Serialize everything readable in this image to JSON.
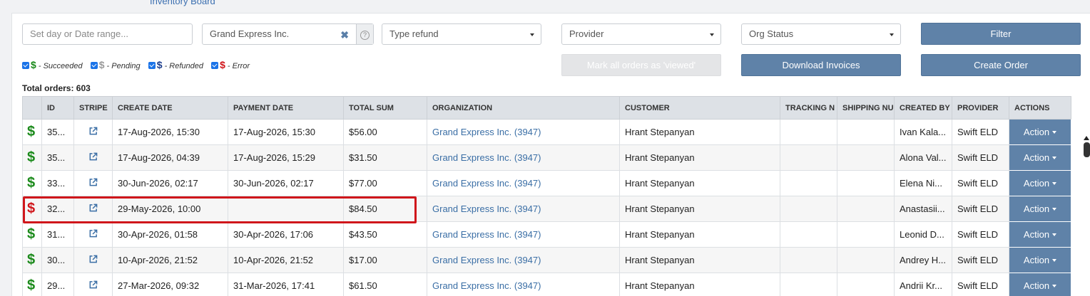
{
  "top_link": "Inventory Board",
  "filters": {
    "date_placeholder": "Set day or Date range...",
    "organization_value": "Grand Express Inc.",
    "refund_type": "Type refund",
    "provider": "Provider",
    "org_status": "Org Status",
    "filter_label": "Filter",
    "mark_viewed_label": "Mark all orders as 'viewed'",
    "download_label": "Download Invoices",
    "create_label": "Create Order"
  },
  "legend": [
    {
      "symbol": "$",
      "label": "- Succeeded",
      "color": "#1b8a1b"
    },
    {
      "symbol": "$",
      "label": "- Pending",
      "color": "#9a9a9a"
    },
    {
      "symbol": "$",
      "label": "- Refunded",
      "color": "#1c3d8c"
    },
    {
      "symbol": "$",
      "label": "- Error",
      "color": "#d0161b"
    }
  ],
  "total_orders": "Total orders: 603",
  "columns": [
    "",
    "ID",
    "STRIPE",
    "CREATE DATE",
    "PAYMENT DATE",
    "TOTAL SUM",
    "ORGANIZATION",
    "CUSTOMER",
    "TRACKING N",
    "SHIPPING NU",
    "CREATED BY",
    "PROVIDER",
    "ACTIONS"
  ],
  "rows": [
    {
      "status": "succeeded",
      "symbol": "$",
      "id": "35...",
      "create_date": "17-Aug-2026, 15:30",
      "payment_date": "17-Aug-2026, 15:30",
      "total": "$56.00",
      "organization": "Grand Express Inc. (3947)",
      "customer": "Hrant Stepanyan",
      "tracking": "",
      "shipping": "",
      "created_by": "Ivan Kala...",
      "provider": "Swift ELD",
      "action": "Action"
    },
    {
      "status": "succeeded",
      "symbol": "$",
      "id": "35...",
      "create_date": "17-Aug-2026, 04:39",
      "payment_date": "17-Aug-2026, 15:29",
      "total": "$31.50",
      "organization": "Grand Express Inc. (3947)",
      "customer": "Hrant Stepanyan",
      "tracking": "",
      "shipping": "",
      "created_by": "Alona Val...",
      "provider": "Swift ELD",
      "action": "Action"
    },
    {
      "status": "succeeded",
      "symbol": "$",
      "id": "33...",
      "create_date": "30-Jun-2026, 02:17",
      "payment_date": "30-Jun-2026, 02:17",
      "total": "$77.00",
      "organization": "Grand Express Inc. (3947)",
      "customer": "Hrant Stepanyan",
      "tracking": "",
      "shipping": "",
      "created_by": "Elena Ni...",
      "provider": "Swift ELD",
      "action": "Action"
    },
    {
      "status": "error",
      "symbol": "$",
      "id": "32...",
      "create_date": "29-May-2026, 10:00",
      "payment_date": "",
      "total": "$84.50",
      "organization": "Grand Express Inc. (3947)",
      "customer": "Hrant Stepanyan",
      "tracking": "",
      "shipping": "",
      "created_by": "Anastasii...",
      "provider": "Swift ELD",
      "action": "Action"
    },
    {
      "status": "succeeded",
      "symbol": "$",
      "id": "31...",
      "create_date": "30-Apr-2026, 01:58",
      "payment_date": "30-Apr-2026, 17:06",
      "total": "$43.50",
      "organization": "Grand Express Inc. (3947)",
      "customer": "Hrant Stepanyan",
      "tracking": "",
      "shipping": "",
      "created_by": "Leonid D...",
      "provider": "Swift ELD",
      "action": "Action"
    },
    {
      "status": "succeeded",
      "symbol": "$",
      "id": "30...",
      "create_date": "10-Apr-2026, 21:52",
      "payment_date": "10-Apr-2026, 21:52",
      "total": "$17.00",
      "organization": "Grand Express Inc. (3947)",
      "customer": "Hrant Stepanyan",
      "tracking": "",
      "shipping": "",
      "created_by": "Andrey H...",
      "provider": "Swift ELD",
      "action": "Action"
    },
    {
      "status": "succeeded",
      "symbol": "$",
      "id": "29...",
      "create_date": "27-Mar-2026, 09:32",
      "payment_date": "31-Mar-2026, 17:41",
      "total": "$61.50",
      "organization": "Grand Express Inc. (3947)",
      "customer": "Hrant Stepanyan",
      "tracking": "",
      "shipping": "",
      "created_by": "Andrii Kr...",
      "provider": "Swift ELD",
      "action": "Action"
    }
  ],
  "status_colors": {
    "succeeded": "#1b8a1b",
    "pending": "#9a9a9a",
    "refunded": "#1c3d8c",
    "error": "#d0161b"
  }
}
